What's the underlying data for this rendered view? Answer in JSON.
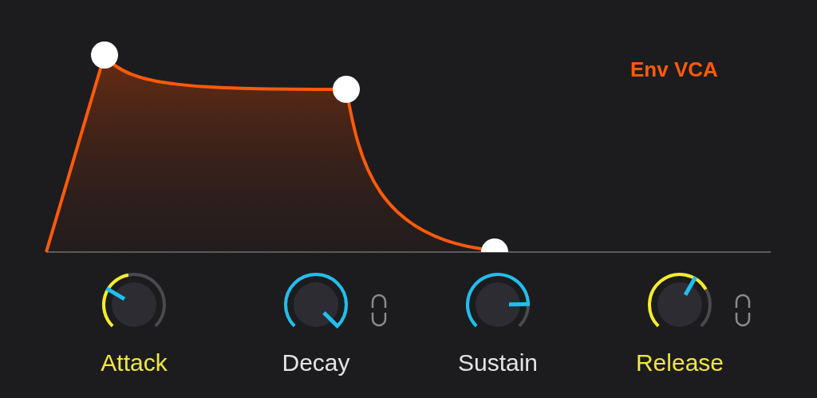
{
  "envelope": {
    "title": "Env VCA"
  },
  "knobs": [
    {
      "label": "Attack",
      "highlighted": true,
      "link": false
    },
    {
      "label": "Decay",
      "highlighted": false,
      "link": true
    },
    {
      "label": "Sustain",
      "highlighted": false,
      "link": false
    },
    {
      "label": "Release",
      "highlighted": true,
      "link": true
    }
  ]
}
